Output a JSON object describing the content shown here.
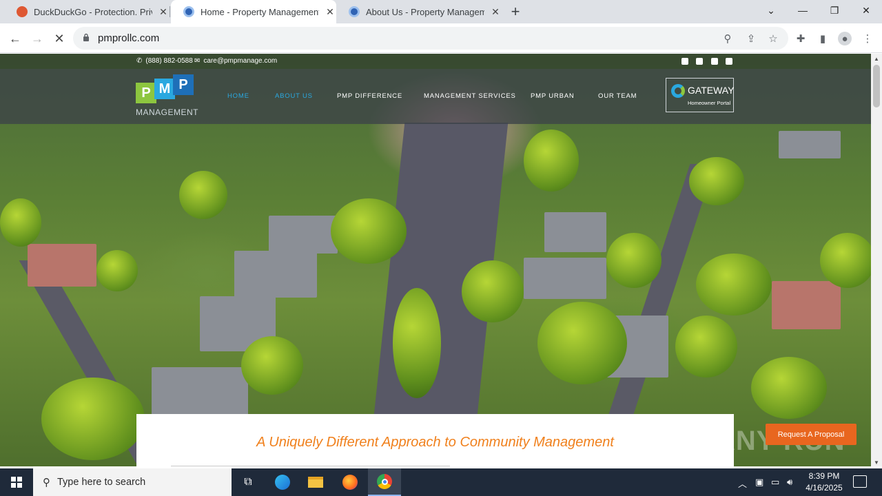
{
  "browser": {
    "tabs": [
      {
        "title": "DuckDuckGo - Protection. Privacy",
        "favicon_color": "#de5833",
        "active": false
      },
      {
        "title": "Home - Property Management Pr",
        "favicon_color": "#2f63b4",
        "active": true
      },
      {
        "title": "About Us - Property Management",
        "favicon_color": "#2f63b4",
        "active": false
      }
    ],
    "new_tab": "+",
    "url": "pmprollc.com"
  },
  "site": {
    "phone": "(888) 882-0588",
    "email": "care@pmpmanage.com",
    "social": [
      "twitter-icon",
      "instagram-icon",
      "facebook-icon",
      "linkedin-icon"
    ],
    "logo": {
      "letters": [
        "P",
        "M",
        "P"
      ],
      "tagline": "MANAGEMENT"
    },
    "menu": [
      {
        "label": "HOME",
        "active": true
      },
      {
        "label": "ABOUT US",
        "active": true
      },
      {
        "label": "PMP DIFFERENCE",
        "active": false
      },
      {
        "label": "MANAGEMENT SERVICES",
        "active": false
      },
      {
        "label": "PMP URBAN",
        "active": false
      },
      {
        "label": "OUR TEAM",
        "active": false
      }
    ],
    "gateway": {
      "title": "GATEWAY",
      "subtitle": "Homeowner Portal"
    },
    "headline": "A Uniquely Different Approach to Community Management",
    "proposal_button": "Request A Proposal",
    "watermark": "ANY RUN"
  },
  "taskbar": {
    "search_placeholder": "Type here to search",
    "time": "8:39 PM",
    "date": "4/16/2025"
  },
  "colors": {
    "accent_orange": "#f0801c",
    "menu_active": "#2aa8e0",
    "proposal_bg": "#e8661f"
  }
}
